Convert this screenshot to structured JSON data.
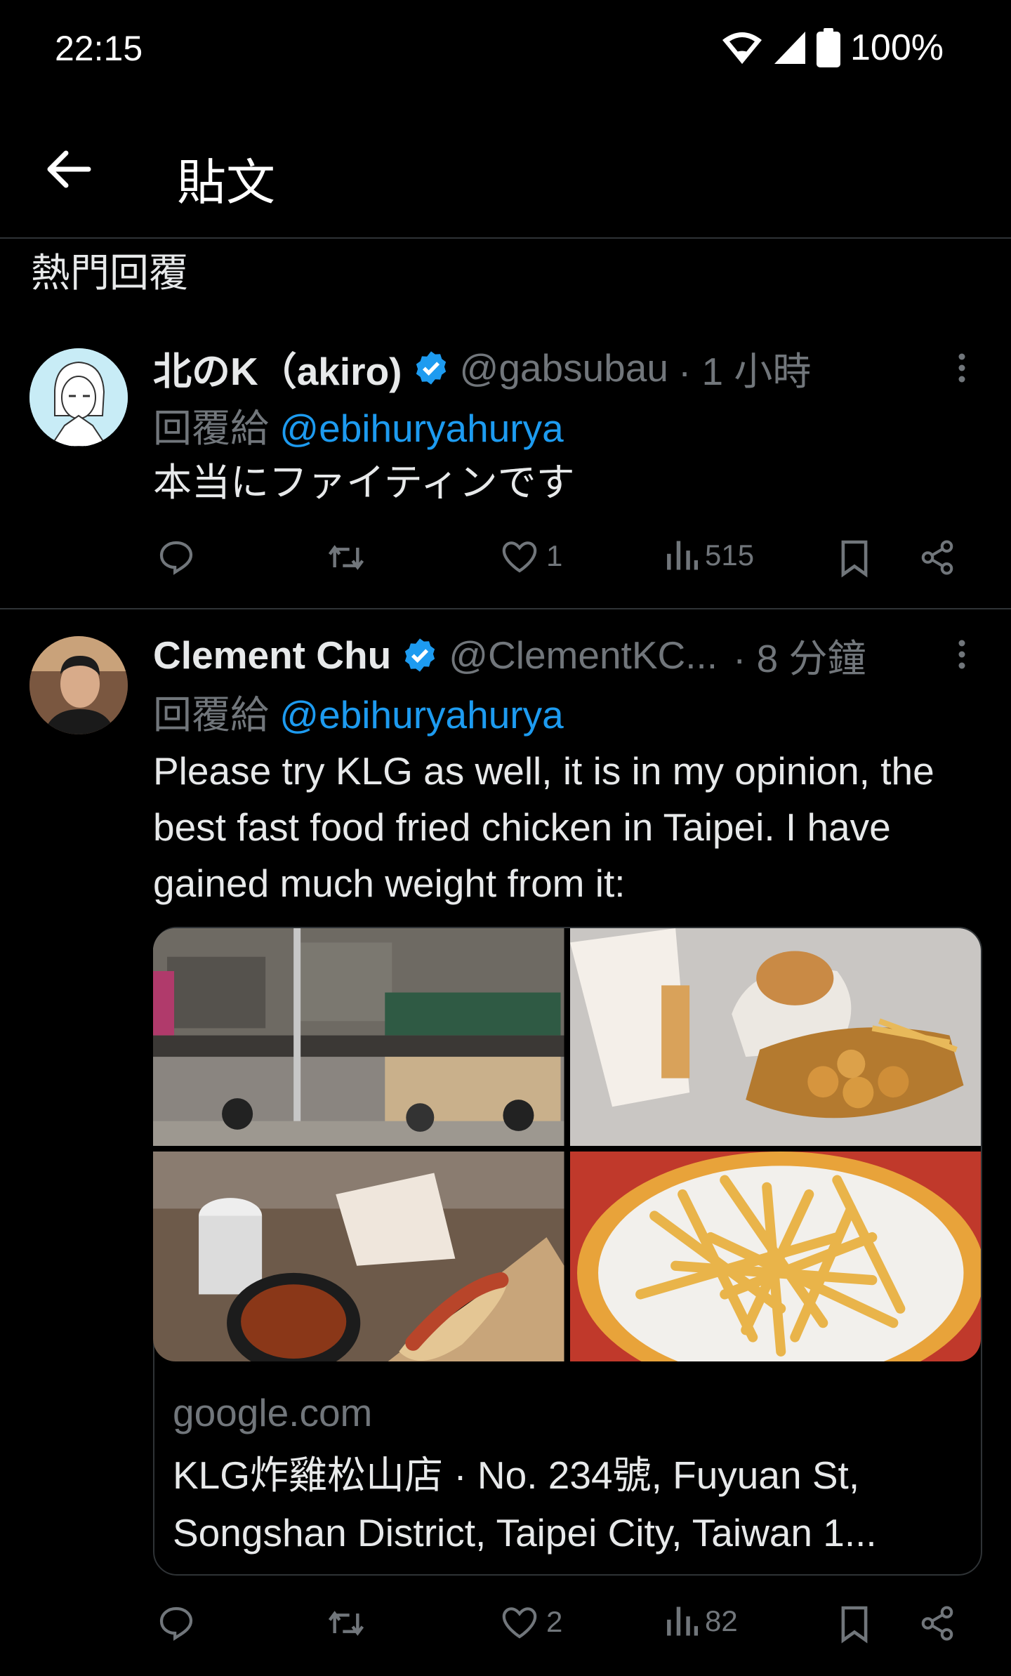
{
  "status_bar": {
    "time": "22:15",
    "battery": "100%"
  },
  "header": {
    "title": "貼文"
  },
  "section": {
    "label": "熱門回覆"
  },
  "tweets": [
    {
      "name": "北のK（akiro)",
      "handle": "@gabsubau",
      "time": "· 1 小時",
      "reply_prefix": "回覆給",
      "reply_to": "@ebihuryahurya",
      "text": "本当にファイティンです",
      "likes": "1",
      "views": "515"
    },
    {
      "name": "Clement Chu",
      "handle": "@ClementKC...",
      "time": "· 8 分鐘",
      "reply_prefix": "回覆給",
      "reply_to": "@ebihuryahurya",
      "text": "Please try KLG as well, it is in my opinion, the best fast food fried chicken in Taipei. I have gained much weight from it:",
      "likes": "2",
      "views": "82",
      "link_card": {
        "domain": "google.com",
        "title": "KLG炸雞松山店 · No. 234號, Fuyuan St, Songshan District, Taipei City, Taiwan 1..."
      }
    }
  ],
  "icons": [
    "back-arrow-icon",
    "wifi-icon",
    "signal-icon",
    "battery-icon",
    "verified-badge-icon",
    "more-options-icon",
    "reply-icon",
    "retweet-icon",
    "like-icon",
    "views-icon",
    "bookmark-icon",
    "share-icon"
  ],
  "colors": {
    "background": "#000000",
    "accent": "#1d9bf0",
    "muted": "#71767b",
    "text": "#e7e9ea",
    "divider": "#2f3336"
  }
}
